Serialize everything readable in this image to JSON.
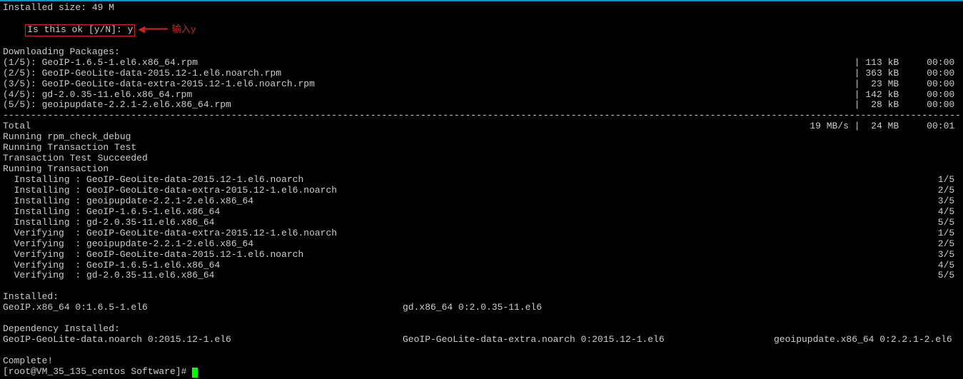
{
  "installed_size": "Installed size: 49 M",
  "prompt": "Is this ok [y/N]: y",
  "annotation_arrow": "◀━━━━",
  "annotation_text": "输入y",
  "downloading": "Downloading Packages:",
  "packages": [
    {
      "left": "(1/5): GeoIP-1.6.5-1.el6.x86_64.rpm",
      "size": "| 113 kB",
      "time": "00:00"
    },
    {
      "left": "(2/5): GeoIP-GeoLite-data-2015.12-1.el6.noarch.rpm",
      "size": "| 363 kB",
      "time": "00:00"
    },
    {
      "left": "(3/5): GeoIP-GeoLite-data-extra-2015.12-1.el6.noarch.rpm",
      "size": "|  23 MB",
      "time": "00:00"
    },
    {
      "left": "(4/5): gd-2.0.35-11.el6.x86_64.rpm",
      "size": "| 142 kB",
      "time": "00:00"
    },
    {
      "left": "(5/5): geoipupdate-2.2.1-2.el6.x86_64.rpm",
      "size": "|  28 kB",
      "time": "00:00"
    }
  ],
  "total_label": "Total",
  "total_speed": "19 MB/s |  24 MB",
  "total_time": "00:01",
  "running_debug": "Running rpm_check_debug",
  "running_test": "Running Transaction Test",
  "test_succeeded": "Transaction Test Succeeded",
  "running_trans": "Running Transaction",
  "transactions": [
    {
      "left": "  Installing : GeoIP-GeoLite-data-2015.12-1.el6.noarch",
      "right": "1/5"
    },
    {
      "left": "  Installing : GeoIP-GeoLite-data-extra-2015.12-1.el6.noarch",
      "right": "2/5"
    },
    {
      "left": "  Installing : geoipupdate-2.2.1-2.el6.x86_64",
      "right": "3/5"
    },
    {
      "left": "  Installing : GeoIP-1.6.5-1.el6.x86_64",
      "right": "4/5"
    },
    {
      "left": "  Installing : gd-2.0.35-11.el6.x86_64",
      "right": "5/5"
    },
    {
      "left": "  Verifying  : GeoIP-GeoLite-data-extra-2015.12-1.el6.noarch",
      "right": "1/5"
    },
    {
      "left": "  Verifying  : geoipupdate-2.2.1-2.el6.x86_64",
      "right": "2/5"
    },
    {
      "left": "  Verifying  : GeoIP-GeoLite-data-2015.12-1.el6.noarch",
      "right": "3/5"
    },
    {
      "left": "  Verifying  : GeoIP-1.6.5-1.el6.x86_64",
      "right": "4/5"
    },
    {
      "left": "  Verifying  : gd-2.0.35-11.el6.x86_64",
      "right": "5/5"
    }
  ],
  "installed_label": "Installed:",
  "installed_items": {
    "col1": "  GeoIP.x86_64 0:1.6.5-1.el6",
    "col2": "gd.x86_64 0:2.0.35-11.el6"
  },
  "dep_label": "Dependency Installed:",
  "dep_items": {
    "col1": "  GeoIP-GeoLite-data.noarch 0:2015.12-1.el6",
    "col2": "GeoIP-GeoLite-data-extra.noarch 0:2015.12-1.el6",
    "col3": "geoipupdate.x86_64 0:2.2.1-2.el6"
  },
  "complete": "Complete!",
  "shell_prompt": "[root@VM_35_135_centos Software]# "
}
